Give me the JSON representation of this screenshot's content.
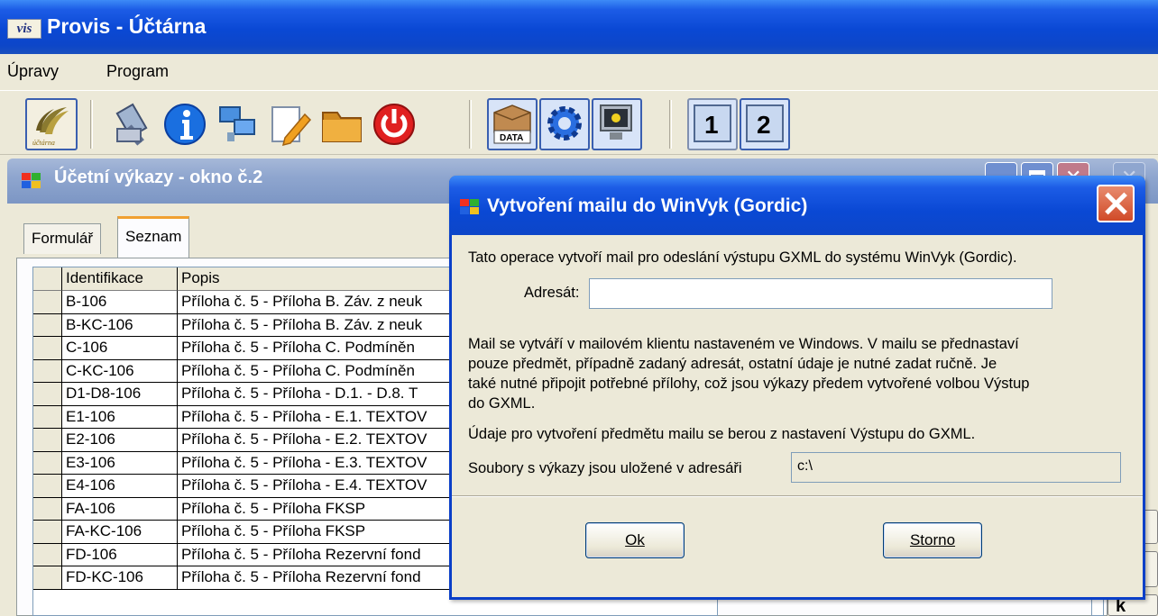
{
  "app": {
    "logo_text": "vis",
    "title": "Provis - Účtárna"
  },
  "menu": [
    "Úpravy",
    "Program"
  ],
  "toolbar": {
    "buttons": [
      {
        "icon": "uctarna-logo-icon",
        "label": "účtárna"
      },
      {
        "icon": "tools-icon"
      },
      {
        "icon": "info-icon"
      },
      {
        "icon": "network-icon"
      },
      {
        "icon": "edit-icon"
      },
      {
        "icon": "folder-icon"
      },
      {
        "icon": "power-icon"
      },
      {
        "icon": "data-box-icon",
        "label": "DATA"
      },
      {
        "icon": "settings-gear-icon"
      },
      {
        "icon": "monitor-icon"
      },
      {
        "icon": "window-1-icon",
        "label": "1"
      },
      {
        "icon": "window-2-icon",
        "label": "2"
      }
    ]
  },
  "child_window": {
    "title": "Účetní výkazy - okno č.2",
    "tabs": [
      "Formulář",
      "Seznam"
    ],
    "active_tab": "Seznam",
    "grid": {
      "columns": [
        "Identifikace",
        "Popis"
      ],
      "rows": [
        {
          "id": "B-106",
          "desc": "Příloha č. 5 - Příloha B. Záv. z neuk"
        },
        {
          "id": "B-KC-106",
          "desc": "Příloha č. 5 - Příloha B. Záv. z neuk"
        },
        {
          "id": "C-106",
          "desc": "Příloha č. 5 - Příloha C. Podmíněn"
        },
        {
          "id": "C-KC-106",
          "desc": "Příloha č. 5 - Příloha C. Podmíněn"
        },
        {
          "id": "D1-D8-106",
          "desc": "Příloha č. 5 - Příloha - D.1. - D.8. T"
        },
        {
          "id": "E1-106",
          "desc": "Příloha č. 5 - Příloha - E.1. TEXTOV"
        },
        {
          "id": "E2-106",
          "desc": "Příloha č. 5 - Příloha - E.2. TEXTOV"
        },
        {
          "id": "E3-106",
          "desc": "Příloha č. 5 - Příloha - E.3. TEXTOV"
        },
        {
          "id": "E4-106",
          "desc": "Příloha č. 5 - Příloha - E.4. TEXTOV"
        },
        {
          "id": "FA-106",
          "desc": "Příloha č. 5 - Příloha FKSP"
        },
        {
          "id": "FA-KC-106",
          "desc": "Příloha č. 5 - Příloha FKSP"
        },
        {
          "id": "FD-106",
          "desc": "Příloha č. 5 - Příloha Rezervní fond"
        },
        {
          "id": "FD-KC-106",
          "desc": "Příloha č. 5 - Příloha Rezervní fond"
        }
      ]
    },
    "side_fragment": "k"
  },
  "dialog": {
    "title": "Vytvoření mailu do WinVyk (Gordic)",
    "intro": "Tato operace vytvoří mail pro odeslání výstupu GXML do systému WinVyk (Gordic).",
    "recipient_label": "Adresát:",
    "recipient_value": "",
    "info_lines": [
      "Mail se vytváří v mailovém klientu nastaveném ve Windows. V mailu se přednastaví",
      "pouze předmět, případně zadaný adresát, ostatní údaje je nutné zadat ručně. Je",
      "také nutné připojit potřebné přílohy, což jsou výkazy předem vytvořené volbou Výstup",
      "do GXML."
    ],
    "subject_note": "Údaje pro vytvoření předmětu mailu se berou z nastavení Výstupu do GXML.",
    "folder_label": "Soubory s výkazy jsou uložené v adresáři",
    "folder_value": "c:\\",
    "ok_label": "Ok",
    "cancel_label": "Storno"
  },
  "colors": {
    "title_blue": "#0a48d4",
    "inactive_title": "#8fa6cf",
    "close_red": "#d04a28",
    "window_bg": "#ece9d8"
  }
}
